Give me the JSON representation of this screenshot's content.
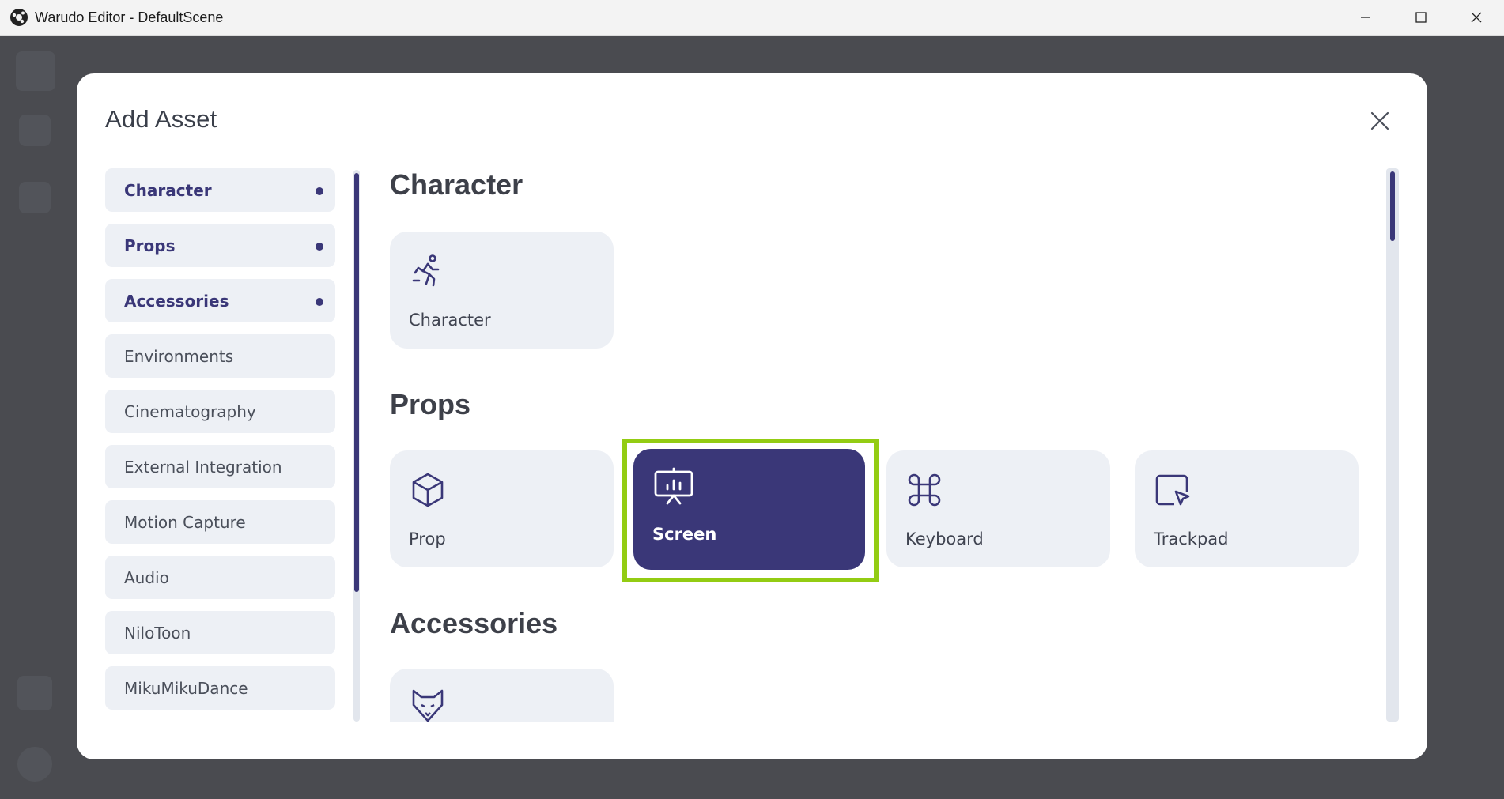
{
  "window": {
    "title": "Warudo Editor - DefaultScene"
  },
  "colors": {
    "accent": "#3a3778",
    "highlight": "#93cc13",
    "card_bg": "#edf0f5"
  },
  "dialog": {
    "title": "Add Asset",
    "categories": [
      {
        "label": "Character",
        "active": true
      },
      {
        "label": "Props",
        "active": true
      },
      {
        "label": "Accessories",
        "active": true
      },
      {
        "label": "Environments",
        "active": false
      },
      {
        "label": "Cinematography",
        "active": false
      },
      {
        "label": "External Integration",
        "active": false
      },
      {
        "label": "Motion Capture",
        "active": false
      },
      {
        "label": "Audio",
        "active": false
      },
      {
        "label": "NiloToon",
        "active": false
      },
      {
        "label": "MikuMikuDance",
        "active": false
      }
    ],
    "sections": {
      "character": {
        "title": "Character",
        "items": [
          {
            "label": "Character",
            "icon": "running-person-icon"
          }
        ]
      },
      "props": {
        "title": "Props",
        "items": [
          {
            "label": "Prop",
            "icon": "cube-icon"
          },
          {
            "label": "Screen",
            "icon": "presentation-screen-icon",
            "selected": true
          },
          {
            "label": "Keyboard",
            "icon": "command-key-icon"
          },
          {
            "label": "Trackpad",
            "icon": "trackpad-cursor-icon"
          }
        ]
      },
      "accessories": {
        "title": "Accessories",
        "items": [
          {
            "label": "",
            "icon": "fox-head-icon"
          }
        ]
      }
    }
  }
}
